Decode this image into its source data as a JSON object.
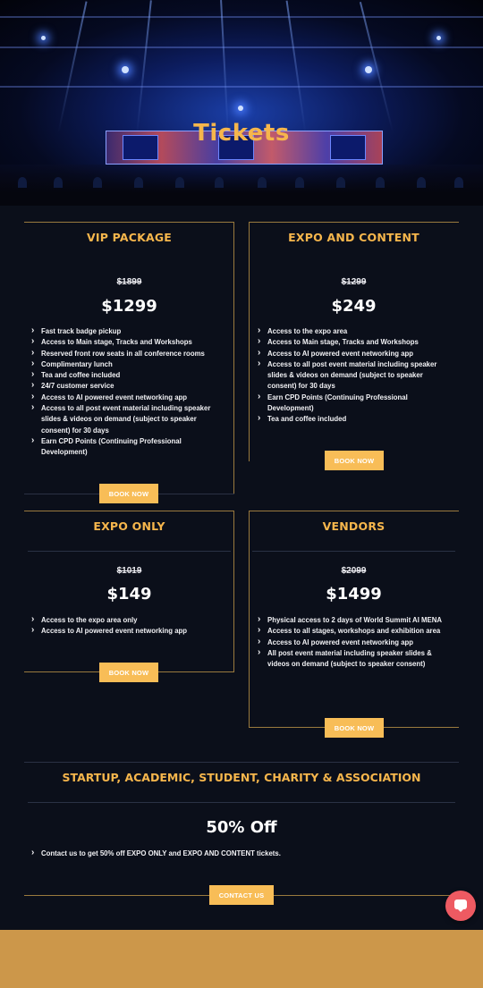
{
  "hero": {
    "title": "Tickets"
  },
  "tickets": [
    {
      "title": "VIP PACKAGE",
      "old_price": "$1899",
      "new_price": "$1299",
      "features": [
        "Fast track badge pickup",
        "Access to Main stage, Tracks and Workshops",
        "Reserved front row seats in all conference rooms",
        "Complimentary lunch",
        "Tea and coffee included",
        "24/7 customer service",
        "Access to AI powered event networking app",
        "Access to all post event material including speaker slides & videos on demand (subject to speaker consent) for 30 days",
        "Earn CPD Points (Continuing Professional Development)"
      ],
      "button": "BOOK NOW"
    },
    {
      "title": "EXPO AND CONTENT",
      "old_price": "$1299",
      "new_price": "$249",
      "features": [
        "Access to the expo area",
        "Access to Main stage, Tracks and Workshops",
        "Access to AI powered event networking app",
        "Access to all post event material including speaker slides & videos on demand (subject to speaker consent) for 30 days",
        "Earn CPD Points (Continuing Professional Development)",
        "Tea and coffee included"
      ],
      "button": "BOOK NOW"
    },
    {
      "title": "EXPO ONLY",
      "old_price": "$1019",
      "new_price": "$149",
      "features": [
        "Access to the expo area only",
        "Access to AI powered event networking app"
      ],
      "button": "BOOK NOW"
    },
    {
      "title": "VENDORS",
      "old_price": "$2099",
      "new_price": "$1499",
      "features": [
        "Physical access to 2 days of World Summit AI MENA",
        "Access to all stages, workshops and exhibition area",
        "Access to AI powered event networking app",
        "All post event material including speaker slides & videos on demand (subject to speaker consent)"
      ],
      "button": "BOOK NOW"
    }
  ],
  "startup": {
    "title": "STARTUP, ACADEMIC, STUDENT, CHARITY & ASSOCIATION",
    "discount": "50% Off",
    "features": [
      "Contact us to get 50% off EXPO ONLY and EXPO AND CONTENT tickets."
    ],
    "button": "CONTACT US"
  },
  "colors": {
    "accent": "#f6b64c",
    "button": "#f8bd57",
    "background": "#0b0f1a",
    "footer": "#cc974a",
    "chat": "#ee5a62"
  },
  "icons": {
    "chat": "chat-bubble-icon",
    "bullet": "chevron-right-icon"
  }
}
